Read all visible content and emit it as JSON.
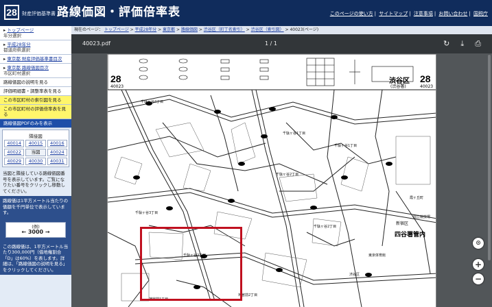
{
  "header": {
    "year_badge": "28",
    "subtitle": "財産評価基準書",
    "title": "路線価図・評価倍率表",
    "links": [
      "このページの使い方",
      "サイトマップ",
      "注意事項",
      "お問い合わせ",
      "国税庁"
    ]
  },
  "sidebar": {
    "nav": [
      {
        "label": "トップページ",
        "sub": "年分選択"
      },
      {
        "label": "平成28年分",
        "sub": "都道府県選択"
      },
      {
        "label": "東京都 財産評価基準書目次",
        "sub": ""
      },
      {
        "label": "東京都 路線価図目次",
        "sub": "市区町村選択"
      }
    ],
    "plain": [
      "路線価図の説明を見る",
      "評価明細書・調整率表を見る"
    ],
    "yellow": [
      "この市区町村の索引図を見る",
      "この市区町村の評価倍率表を見る"
    ],
    "pdf_only": "路線価図PDFのみを表示",
    "adjacent": {
      "heading": "隣接図",
      "cells": [
        "40014",
        "40015",
        "40016",
        "40022",
        "当図",
        "40024",
        "40029",
        "40030",
        "40031"
      ]
    },
    "adjacent_note": "当図と隣接している路線価図番号を表示しています。ご覧になりたい番号をクリックし移動してください。",
    "unit_note": "路線価は1平方メートル当たりの価額を千円単位で表示しています。",
    "example_tag": "(例)",
    "example_value": "3000",
    "example_desc": "この路線価は、1平方メートル当たり300,000円（借地権割合「D」は60%）を表します。詳細は、「路線価図の説明を見る」をクリックしてください。"
  },
  "breadcrumb": {
    "prefix": "現在のページ：",
    "items": [
      "トップページ",
      "平成28年分",
      "東京都",
      "路線価図",
      "渋谷区（町丁名索引）",
      "渋谷区（索引図）"
    ],
    "current": "40023(ページ)"
  },
  "pdf": {
    "filename": "40023.pdf",
    "page_indicator": "1 / 1",
    "icons": {
      "rotate": "rotate-icon",
      "download": "download-icon",
      "print": "print-icon"
    },
    "fabs": [
      "fit-page-icon",
      "zoom-in-icon",
      "zoom-out-icon"
    ]
  },
  "map": {
    "code_left": "28",
    "code_left_sub": "40023",
    "ward": "渋谷区",
    "office": "(渋谷署)",
    "code_right": "28",
    "code_right_sub": "40023",
    "station": "四谷署管内",
    "tax_office_ward": "新宿区",
    "labels": [
      "千駄ヶ谷4丁目",
      "千駄ヶ谷1丁目",
      "千駄ヶ谷1丁目",
      "千駄ヶ谷2丁目",
      "千駄ヶ谷3丁目",
      "千駄ヶ谷2丁目",
      "千駄ヶ谷2丁目",
      "神宮前2丁目",
      "神宮前1丁目",
      "渋谷区",
      "霞ヶ丘町",
      "国立競技場",
      "東京体育館"
    ]
  }
}
